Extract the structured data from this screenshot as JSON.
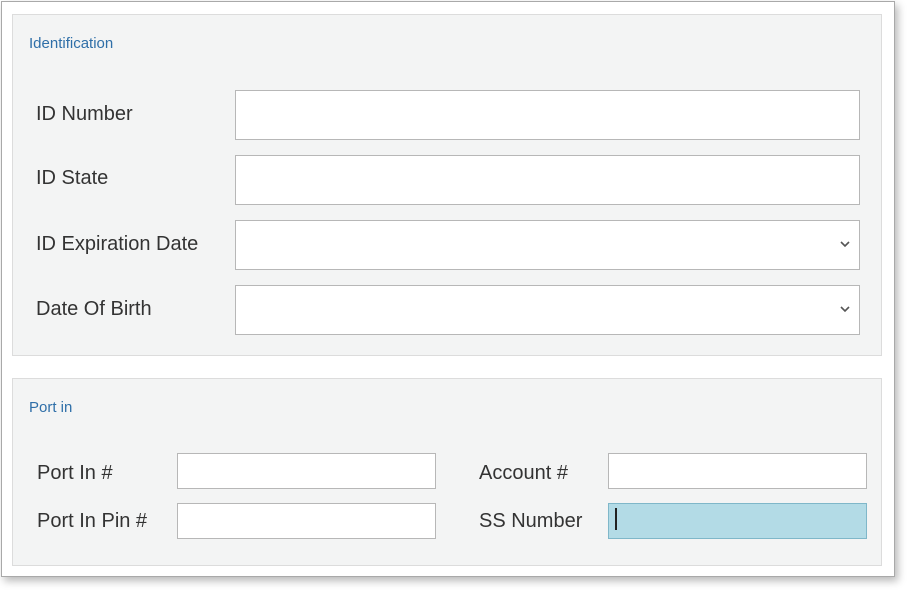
{
  "identification": {
    "title": "Identification",
    "id_number_label": "ID Number",
    "id_number_value": "",
    "id_state_label": "ID State",
    "id_state_value": "",
    "id_expiration_label": "ID Expiration Date",
    "id_expiration_value": "",
    "dob_label": "Date Of Birth",
    "dob_value": ""
  },
  "port_in": {
    "title": "Port in",
    "port_in_label": "Port In #",
    "port_in_value": "",
    "port_in_pin_label": "Port In Pin #",
    "port_in_pin_value": "",
    "account_label": "Account #",
    "account_value": "",
    "ss_number_label": "SS Number",
    "ss_number_value": ""
  },
  "icons": {
    "dropdown": "chevron-down-icon"
  },
  "colors": {
    "group_title": "#2f6fa8",
    "active_field": "#b3dbe6",
    "panel_bg": "#f3f4f4"
  }
}
